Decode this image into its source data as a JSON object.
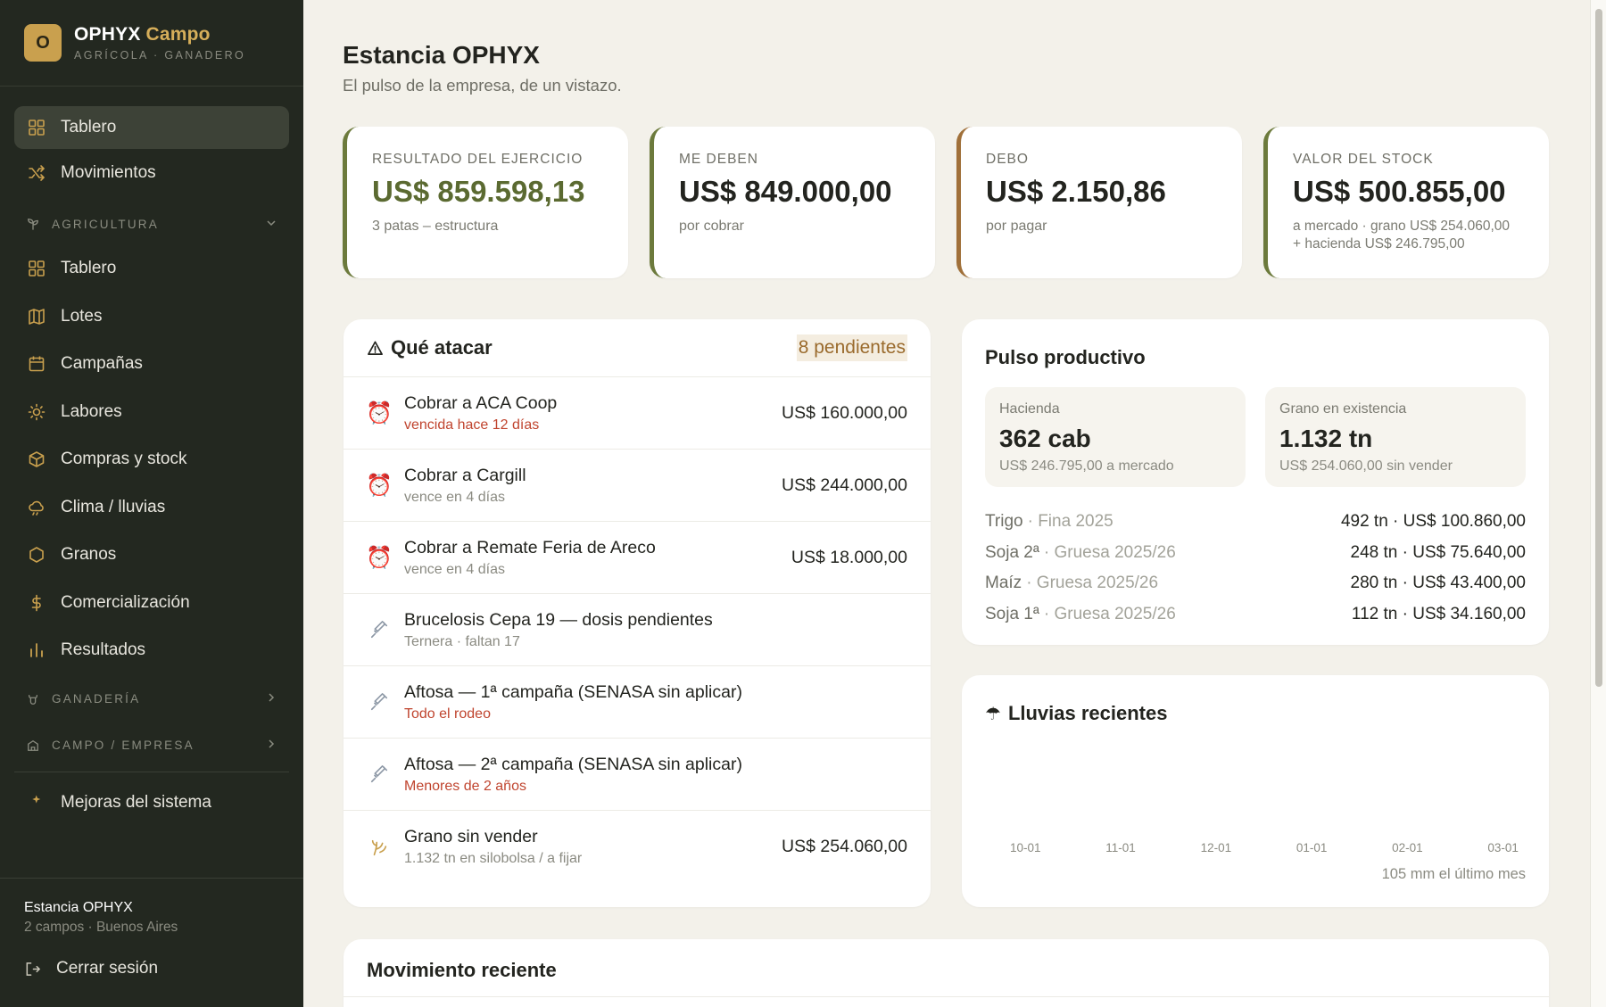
{
  "brand": {
    "logo_letter": "O",
    "name": "OPHYX",
    "accent": "Campo",
    "subtitle": "AGRÍCOLA · GANADERO"
  },
  "nav": {
    "top": [
      {
        "label": "Tablero",
        "icon": "grid-icon",
        "active": true
      },
      {
        "label": "Movimientos",
        "icon": "shuffle-icon",
        "active": false
      }
    ],
    "agricultura": {
      "label": "AGRICULTURA",
      "items": [
        {
          "label": "Tablero",
          "icon": "grid-icon"
        },
        {
          "label": "Lotes",
          "icon": "map-icon"
        },
        {
          "label": "Campañas",
          "icon": "calendar-icon"
        },
        {
          "label": "Labores",
          "icon": "sun-icon"
        },
        {
          "label": "Compras y stock",
          "icon": "box-icon"
        },
        {
          "label": "Clima / lluvias",
          "icon": "cloud-icon"
        },
        {
          "label": "Granos",
          "icon": "hexagon-icon"
        },
        {
          "label": "Comercialización",
          "icon": "dollar-icon"
        },
        {
          "label": "Resultados",
          "icon": "bar-chart-icon"
        }
      ]
    },
    "ganaderia": {
      "label": "GANADERÍA"
    },
    "campo": {
      "label": "CAMPO / EMPRESA"
    },
    "mejoras": {
      "label": "Mejoras del sistema",
      "icon": "sparkle-icon"
    }
  },
  "footer": {
    "org_name": "Estancia OPHYX",
    "org_sub": "2 campos · Buenos Aires",
    "logout": "Cerrar sesión"
  },
  "page": {
    "title": "Estancia OPHYX",
    "subtitle": "El pulso de la empresa, de un vistazo."
  },
  "kpis": [
    {
      "label": "RESULTADO DEL EJERCICIO",
      "value": "US$ 859.598,13",
      "note": "3 patas – estructura",
      "note2": ""
    },
    {
      "label": "ME DEBEN",
      "value": "US$ 849.000,00",
      "note": "por cobrar",
      "note2": ""
    },
    {
      "label": "DEBO",
      "value": "US$ 2.150,86",
      "note": "por pagar",
      "note2": ""
    },
    {
      "label": "VALOR DEL STOCK",
      "value": "US$ 500.855,00",
      "note": "a mercado · grano US$ 254.060,00",
      "note2": "+ hacienda US$ 246.795,00"
    }
  ],
  "attack": {
    "title": "Qué atacar",
    "pending": "8 pendientes",
    "items": [
      {
        "icon": "alarm-clock-icon",
        "title": "Cobrar a ACA Coop",
        "sub": "vencida hace 12 días",
        "amount": "US$ 160.000,00"
      },
      {
        "icon": "alarm-clock-icon",
        "title": "Cobrar a Cargill",
        "sub": "vence en 4 días",
        "amount": "US$ 244.000,00"
      },
      {
        "icon": "alarm-clock-icon",
        "title": "Cobrar a Remate Feria de Areco",
        "sub": "vence en 4 días",
        "amount": "US$ 18.000,00"
      },
      {
        "icon": "syringe-icon",
        "title": "Brucelosis Cepa 19 — dosis pendientes",
        "sub": "Ternera · faltan 17",
        "amount": ""
      },
      {
        "icon": "syringe-icon",
        "title": "Aftosa — 1ª campaña (SENASA sin aplicar)",
        "sub": "Todo el rodeo",
        "amount": ""
      },
      {
        "icon": "syringe-icon",
        "title": "Aftosa — 2ª campaña (SENASA sin aplicar)",
        "sub": "Menores de 2 años",
        "amount": ""
      },
      {
        "icon": "wheat-icon",
        "title": "Grano sin vender",
        "sub": "1.132 tn en silobolsa / a fijar",
        "amount": "US$ 254.060,00"
      }
    ]
  },
  "pulse": {
    "title": "Pulso productivo",
    "hacienda": {
      "label": "Hacienda",
      "value": "362 cab",
      "note": "US$ 246.795,00 a mercado"
    },
    "grano": {
      "label": "Grano en existencia",
      "value": "1.132 tn",
      "note": "US$ 254.060,00 sin vender"
    },
    "rows": [
      {
        "crop": "Trigo",
        "campaign": "· Fina 2025",
        "value": "492 tn · US$ 100.860,00"
      },
      {
        "crop": "Soja 2ª",
        "campaign": "· Gruesa 2025/26",
        "value": "248 tn · US$ 75.640,00"
      },
      {
        "crop": "Maíz",
        "campaign": "· Gruesa 2025/26",
        "value": "280 tn · US$ 43.400,00"
      },
      {
        "crop": "Soja 1ª",
        "campaign": "· Gruesa 2025/26",
        "value": "112 tn · US$ 34.160,00"
      }
    ]
  },
  "rain": {
    "title": "Lluvias recientes",
    "axis": [
      "10-01",
      "11-01",
      "12-01",
      "01-01",
      "02-01",
      "03-01"
    ],
    "note": "105 mm el último mes"
  },
  "recent": {
    "title": "Movimiento reciente"
  },
  "colors": {
    "sidebar": "#232820",
    "accent": "#c9a04e",
    "green": "#5b6a31",
    "red": "#c0452f",
    "background": "#f3f1ea"
  }
}
